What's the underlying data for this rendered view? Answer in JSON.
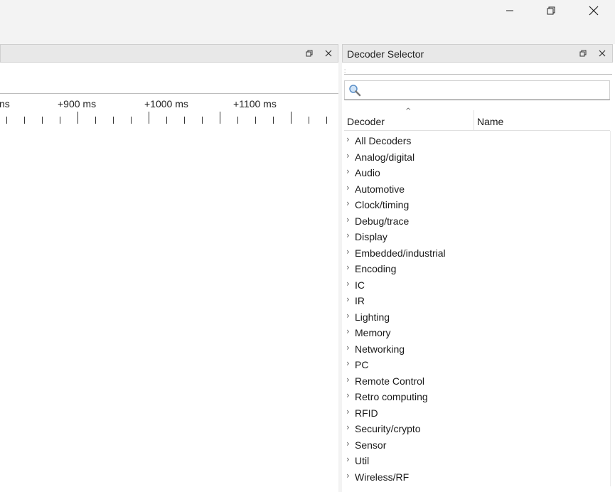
{
  "window": {
    "minimize_glyph": "—",
    "restore_glyph": "❐",
    "close_glyph": "✕"
  },
  "left_panel": {
    "ruler_labels": [
      "ns",
      "+900 ms",
      "+1000 ms",
      "+1100 ms"
    ]
  },
  "decoder_selector": {
    "title": "Decoder Selector",
    "search_placeholder": "",
    "columns": [
      "Decoder",
      "Name"
    ],
    "items": [
      "All Decoders",
      "Analog/digital",
      "Audio",
      "Automotive",
      "Clock/timing",
      "Debug/trace",
      "Display",
      "Embedded/industrial",
      "Encoding",
      "IC",
      "IR",
      "Lighting",
      "Memory",
      "Networking",
      "PC",
      "Remote Control",
      "Retro computing",
      "RFID",
      "Security/crypto",
      "Sensor",
      "Util",
      "Wireless/RF"
    ]
  }
}
